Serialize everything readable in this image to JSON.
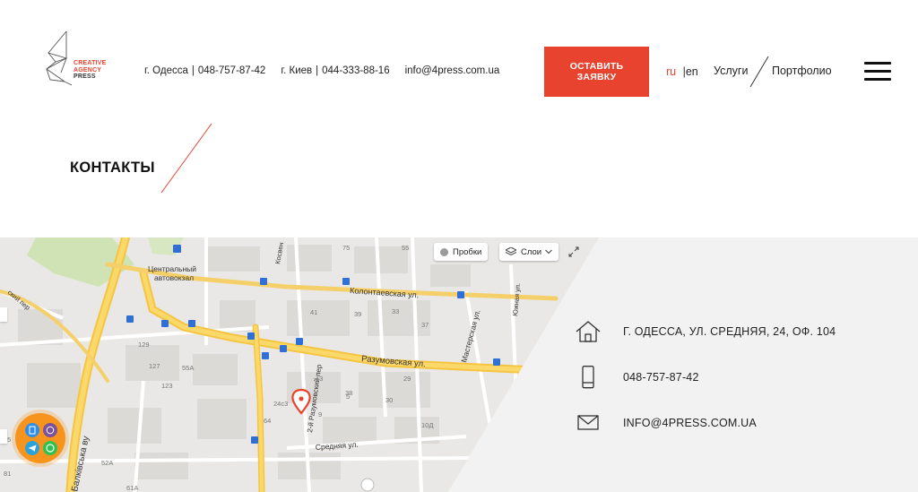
{
  "header": {
    "logo_lines": [
      "CREATIVE",
      "AGENCY",
      "PRESS"
    ],
    "contacts": [
      {
        "city": "г. Одесса",
        "phone": "048-757-87-42"
      },
      {
        "city": "г. Киев",
        "phone": "044-333-88-16"
      }
    ],
    "email": "info@4press.com.ua",
    "cta_label": "ОСТАВИТЬ ЗАЯВКУ",
    "lang_active": "ru",
    "lang_separator": "|",
    "lang_other": "en",
    "nav": {
      "services": "Услуги",
      "portfolio": "Портфолио"
    },
    "accent_color": "#e8432e"
  },
  "page": {
    "title": "КОНТАКТЫ"
  },
  "map": {
    "controls": {
      "traffic": "Пробки",
      "layers": "Слои"
    },
    "labels": {
      "bus_station_1": "Центральный",
      "bus_station_2": "автовокзал",
      "street_kolontaevskaya": "Колонтаевская ул.",
      "street_razumovskaya": "Разумовская ул.",
      "street_masterskaya": "Мастерская ул.",
      "street_srednyaya": "Средняя ул.",
      "street_razumovsky_per": "2-й Разумовский пер",
      "street_yuzhnaya": "Южная ул.",
      "street_kosvennaya": "Косвен",
      "street_balkivska": "Балківська ву",
      "street_per": "ский пер",
      "n_75": "75",
      "n_55": "55",
      "n_39": "39",
      "n_41": "41",
      "n_33": "33",
      "n_38": "38",
      "n_13": "13",
      "n_129": "129",
      "n_127": "127",
      "n_55a": "55А",
      "n_123": "123",
      "n_64": "64",
      "n_9": "9",
      "n_10d": "10Д",
      "n_24": "24с3",
      "n_52a": "52А",
      "n_61a": "61А",
      "n_85": "85",
      "n_81": "81",
      "n_5": "5",
      "n_29": "29",
      "n_30": "30",
      "n_37": "37"
    }
  },
  "contact_block": {
    "address": "Г. ОДЕССА, УЛ. СРЕДНЯЯ, 24, ОФ. 104",
    "phone": "048-757-87-42",
    "email": "INFO@4PRESS.COM.UA"
  }
}
